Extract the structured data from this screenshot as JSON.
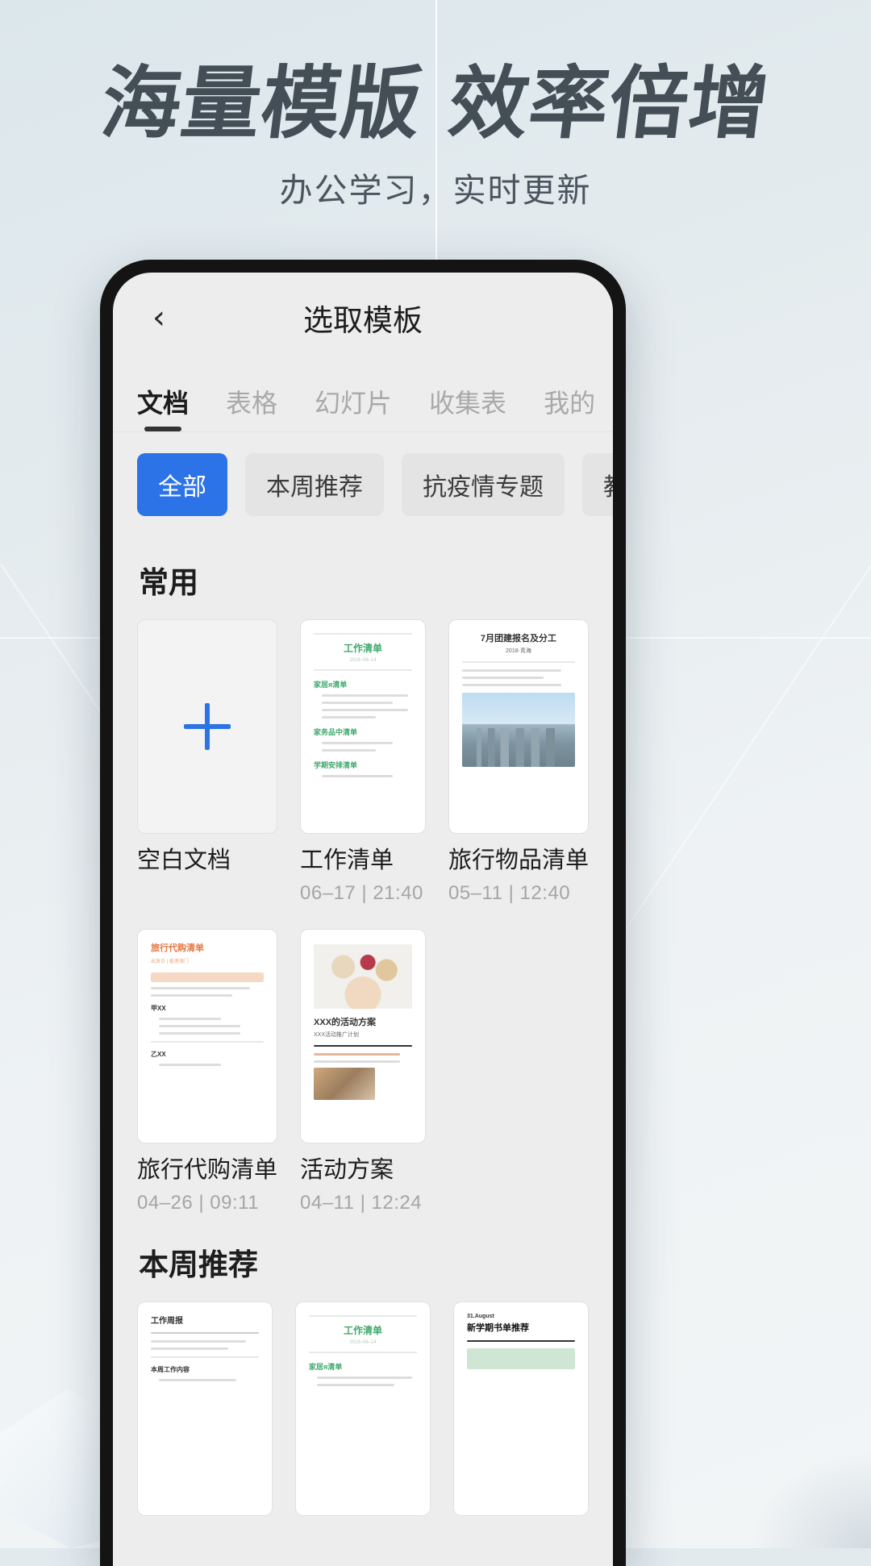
{
  "promo": {
    "title": "海量模版 效率倍增",
    "subtitle": "办公学习，实时更新"
  },
  "colors": {
    "accent_blue": "#2c73e8",
    "chip_bg": "#e4e4e4",
    "screen_bg": "#ededed",
    "text_primary": "#1d1d1d",
    "text_muted": "#a5a5a5",
    "promo_title": "#444e57"
  },
  "navbar": {
    "back_icon": "‹",
    "title": "选取模板"
  },
  "tabs": [
    {
      "label": "文档",
      "active": true
    },
    {
      "label": "表格",
      "active": false
    },
    {
      "label": "幻灯片",
      "active": false
    },
    {
      "label": "收集表",
      "active": false
    },
    {
      "label": "我的",
      "active": false
    }
  ],
  "chips": [
    {
      "label": "全部",
      "active": true
    },
    {
      "label": "本周推荐",
      "active": false
    },
    {
      "label": "抗疫情专题",
      "active": false
    },
    {
      "label": "教育",
      "active": false
    }
  ],
  "sections": [
    {
      "title": "常用",
      "cards": [
        {
          "label": "空白文档",
          "date": "",
          "kind": "blank"
        },
        {
          "label": "工作清单",
          "date": "06–17 | 21:40",
          "kind": "worklist"
        },
        {
          "label": "旅行物品清单",
          "date": "05–11 | 12:40",
          "kind": "travel-items"
        },
        {
          "label": "旅行代购清单",
          "date": "04–26 | 09:11",
          "kind": "travel-buy"
        },
        {
          "label": "活动方案",
          "date": "04–11 | 12:24",
          "kind": "event-plan"
        }
      ]
    },
    {
      "title": "本周推荐",
      "cards": [
        {
          "label": "",
          "date": "",
          "kind": "weekly-report"
        },
        {
          "label": "",
          "date": "",
          "kind": "worklist"
        },
        {
          "label": "",
          "date": "",
          "kind": "booklist"
        }
      ]
    }
  ],
  "thumb_text": {
    "worklist_title": "工作清单",
    "worklist_sub": "2018–06–14",
    "worklist_h1": "家居я清单",
    "worklist_h2": "家务品中清单",
    "worklist_h3": "学期安排清单",
    "travel_title": "7月团建报名及分工",
    "travel_sub": "2018·青海",
    "travelbuy_title": "旅行代购清单",
    "travelbuy_sub": "出发日 | 香港澳门",
    "event_title": "XXX的活动方案",
    "event_sub": "XXX活动推广计划",
    "weekly_title": "工作周报",
    "book_date": "31.August",
    "book_title": "新学期书单推荐"
  }
}
